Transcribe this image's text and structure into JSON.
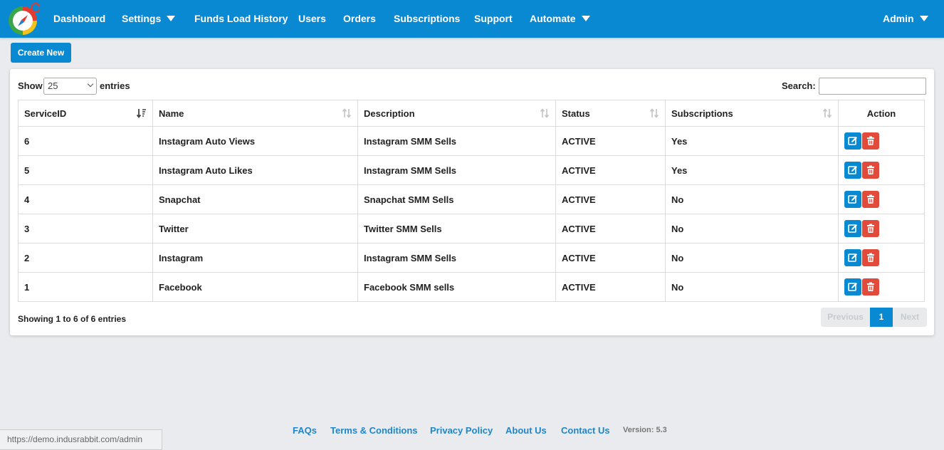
{
  "nav": {
    "items": [
      {
        "label": "Dashboard",
        "dropdown": false
      },
      {
        "label": "Settings",
        "dropdown": true
      },
      {
        "label": "Funds Load History",
        "dropdown": false
      },
      {
        "label": "Users",
        "dropdown": false
      },
      {
        "label": "Orders",
        "dropdown": false
      },
      {
        "label": "Subscriptions",
        "dropdown": false
      },
      {
        "label": "Support",
        "dropdown": false
      },
      {
        "label": "Automate",
        "dropdown": true
      }
    ],
    "user_label": "Admin",
    "brand_color": "#0a89d3"
  },
  "create_button": "Create New",
  "length_control": {
    "show": "Show",
    "value": "25",
    "entries": "entries"
  },
  "search": {
    "label": "Search:",
    "value": ""
  },
  "table": {
    "columns": [
      "ServiceID",
      "Name",
      "Description",
      "Status",
      "Subscriptions",
      "Action"
    ],
    "rows": [
      [
        "6",
        "Instagram Auto Views",
        "Instagram SMM Sells",
        "ACTIVE",
        "Yes"
      ],
      [
        "5",
        "Instagram Auto Likes",
        "Instagram SMM Sells",
        "ACTIVE",
        "Yes"
      ],
      [
        "4",
        "Snapchat",
        "Snapchat SMM Sells",
        "ACTIVE",
        "No"
      ],
      [
        "3",
        "Twitter",
        "Twitter SMM Sells",
        "ACTIVE",
        "No"
      ],
      [
        "2",
        "Instagram",
        "Instagram SMM Sells",
        "ACTIVE",
        "No"
      ],
      [
        "1",
        "Facebook",
        "Facebook SMM sells",
        "ACTIVE",
        "No"
      ]
    ],
    "action_icons": [
      "edit-icon",
      "trash-icon"
    ],
    "edit_color": "#0a89d3",
    "delete_color": "#e24a3b"
  },
  "info": "Showing 1 to 6 of 6 entries",
  "pagination": {
    "previous": "Previous",
    "current": "1",
    "next": "Next"
  },
  "footer": {
    "links": [
      "FAQs",
      "Terms & Conditions",
      "Privacy Policy",
      "About Us",
      "Contact Us"
    ],
    "version": "Version: 5.3"
  },
  "status_url": "https://demo.indusrabbit.com/admin"
}
